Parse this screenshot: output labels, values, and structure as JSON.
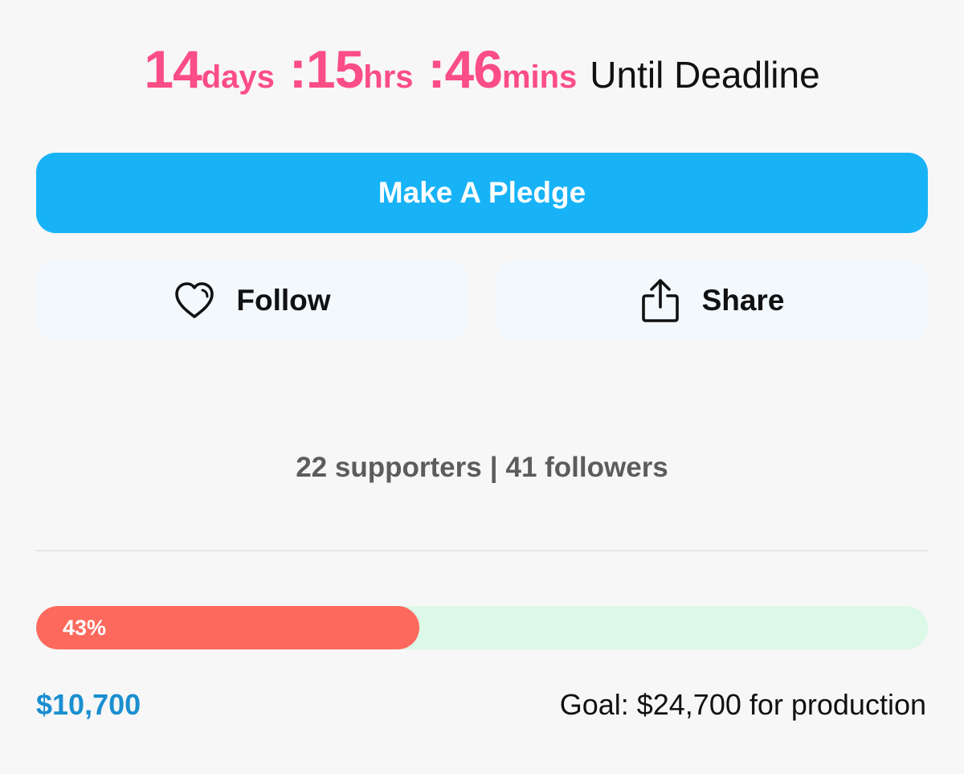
{
  "countdown": {
    "days_value": "14",
    "days_unit": "days",
    "hours_value": ":15",
    "hours_unit": "hrs",
    "mins_value": ":46",
    "mins_unit": "mins",
    "label": "Until Deadline"
  },
  "pledge_button": {
    "label": "Make A Pledge"
  },
  "follow_button": {
    "label": "Follow",
    "icon": "heart-icon"
  },
  "share_button": {
    "label": "Share",
    "icon": "share-icon"
  },
  "stats": {
    "supporters": "22 supporters",
    "separator": "|",
    "followers": "41 followers"
  },
  "funding": {
    "percent": 43,
    "percent_label": "43%",
    "raised": "$10,700",
    "goal": "Goal: $24,700 for production"
  },
  "colors": {
    "countdown": "#fb4d86",
    "primary_button": "#18b3f7",
    "progress_fill": "#fd6a5d",
    "progress_track": "#dcf8e6",
    "raised_amount": "#1a8fd0"
  }
}
